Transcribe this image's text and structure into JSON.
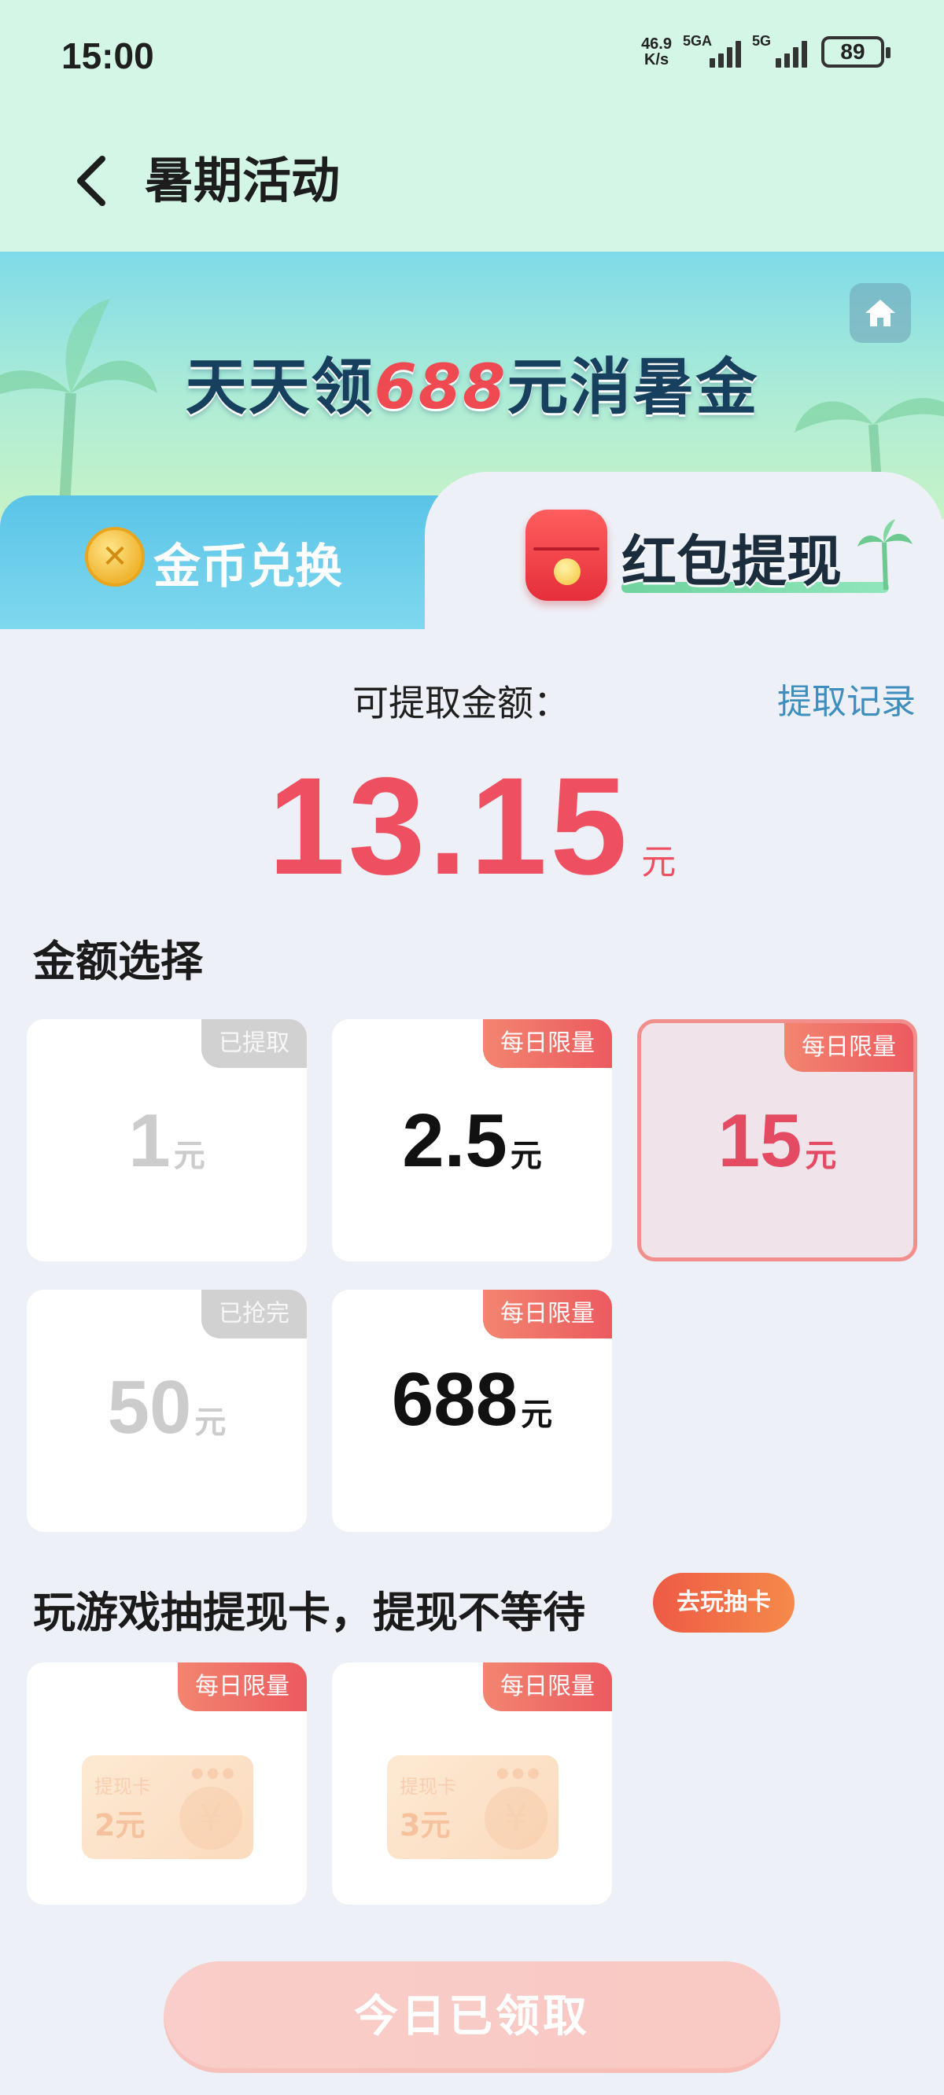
{
  "status_bar": {
    "time": "15:00",
    "net_speed_value": "46.9",
    "net_speed_unit": "K/s",
    "signal1_label": "5GA",
    "signal2_label": "5G",
    "battery": "89"
  },
  "header": {
    "title": "暑期活动"
  },
  "banner": {
    "title_prefix": "天天领",
    "title_highlight": "688",
    "title_suffix": "元消暑金"
  },
  "tabs": {
    "coins_label": "金币兑换",
    "redpacket_label": "红包提现"
  },
  "balance": {
    "label": "可提取金额：",
    "record_link": "提取记录",
    "amount": "13.15",
    "unit": "元"
  },
  "amount_section": {
    "title": "金额选择",
    "options": [
      {
        "amount": "1",
        "unit": "元",
        "tag": "已提取",
        "state": "disabled"
      },
      {
        "amount": "2.5",
        "unit": "元",
        "tag": "每日限量",
        "state": "available"
      },
      {
        "amount": "15",
        "unit": "元",
        "tag": "每日限量",
        "state": "selected"
      },
      {
        "amount": "50",
        "unit": "元",
        "tag": "已抢完",
        "state": "disabled"
      },
      {
        "amount": "688",
        "unit": "元",
        "tag": "每日限量",
        "state": "available"
      }
    ]
  },
  "game_section": {
    "title": "玩游戏抽提现卡，提现不等待",
    "play_button": "去玩抽卡",
    "cards": [
      {
        "tag": "每日限量",
        "card_label": "提现卡",
        "card_amount": "2元"
      },
      {
        "tag": "每日限量",
        "card_label": "提现卡",
        "card_amount": "3元"
      }
    ]
  },
  "claim_button": "今日已领取",
  "colors": {
    "accent_red": "#ee5061",
    "link_blue": "#3e8fbd",
    "header_bg": "#d3f6e6"
  }
}
